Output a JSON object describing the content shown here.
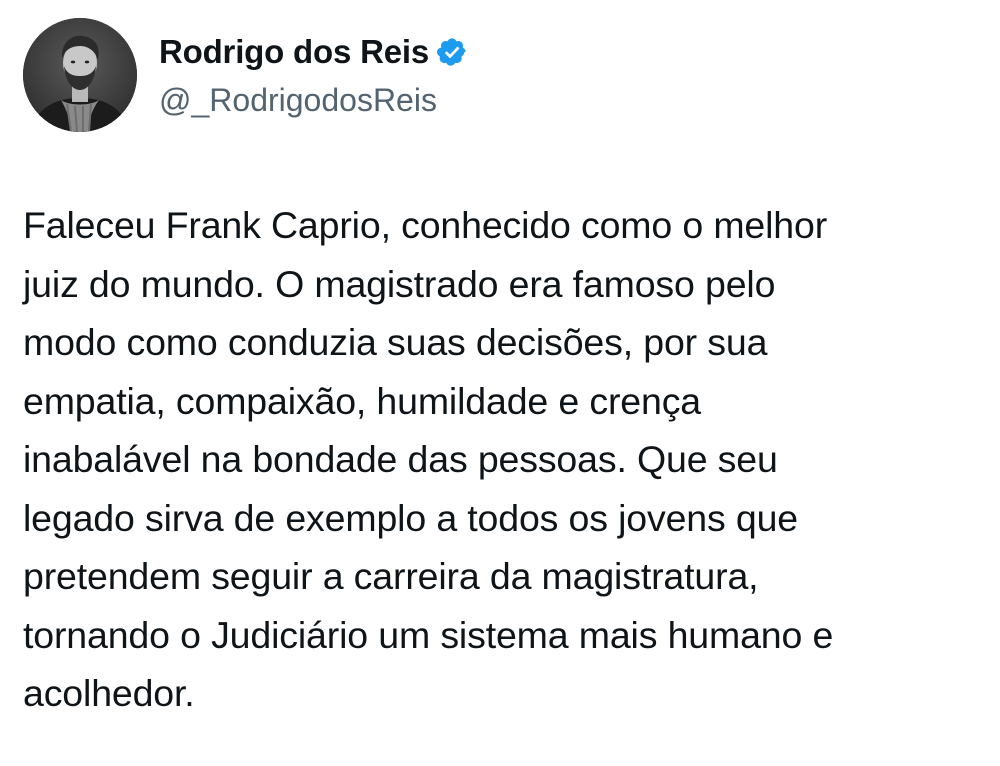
{
  "author": {
    "display_name": "Rodrigo dos Reis",
    "handle": "@_RodrigodosReis",
    "verified": true,
    "avatar_icon": "profile-photo-bearded-man-scarf",
    "verified_color": "#1d9bf0"
  },
  "tweet": {
    "lines": [
      "Faleceu Frank Caprio, conhecido como o melhor",
      "juiz do mundo. O magistrado era famoso pelo",
      "modo como conduzia suas decisões, por sua",
      "empatia, compaixão, humildade e crença",
      "inabalável na bondade das pessoas. Que seu",
      "legado sirva de exemplo a todos os jovens que",
      "pretendem seguir a carreira da magistratura,",
      "tornando o Judiciário um sistema mais humano e",
      "acolhedor."
    ]
  }
}
